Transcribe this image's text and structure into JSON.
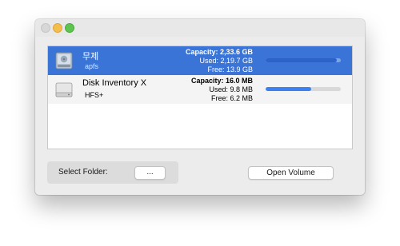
{
  "window": {
    "traffic_lights": {
      "close_color": "#d7d7d7",
      "minimize_color": "#f4be4f",
      "zoom_color": "#5ec450"
    }
  },
  "volumes": [
    {
      "name": "무제",
      "filesystem": "apfs",
      "capacity_text": "Capacity: 2,33.6 GB",
      "used_text": "Used: 2,19.7 GB",
      "free_text": "Free: 13.9 GB",
      "usage_fraction": 0.95,
      "selected": true,
      "icon": "internal-disk-icon"
    },
    {
      "name": "Disk Inventory X",
      "filesystem": "HFS+",
      "capacity_text": "Capacity: 16.0 MB",
      "used_text": "Used: 9.8 MB",
      "free_text": "Free: 6.2 MB",
      "usage_fraction": 0.61,
      "selected": false,
      "icon": "disk-image-icon"
    }
  ],
  "folder": {
    "label": "Select Folder:",
    "browse_label": "..."
  },
  "actions": {
    "open_volume_label": "Open Volume"
  },
  "colors": {
    "selection": "#3a74d6",
    "bar_fill_selected": "#2d63c8",
    "bar_fill": "#3b82f0"
  }
}
